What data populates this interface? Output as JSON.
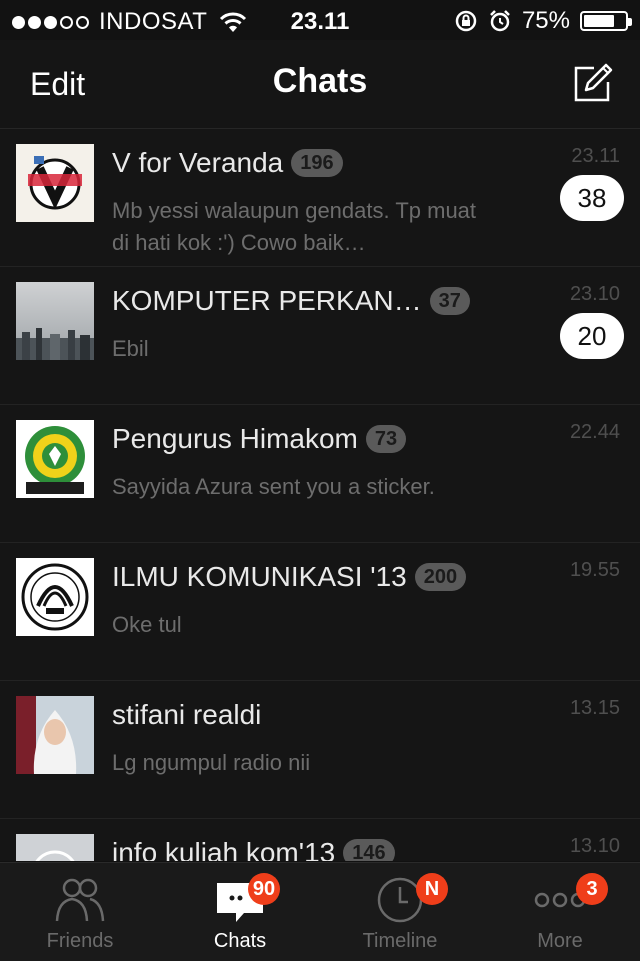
{
  "status_bar": {
    "carrier": "INDOSAT",
    "signal_bars_filled": 3,
    "signal_bars_total": 5,
    "time": "23.11",
    "battery": "75%",
    "battery_level": 0.75
  },
  "nav": {
    "edit_label": "Edit",
    "title": "Chats",
    "compose_icon": "compose-icon"
  },
  "chats": [
    {
      "name": "V for Veranda",
      "count": "196",
      "message": "Mb yessi walaupun gendats. Tp muat di hati kok :')   Cowo baik…",
      "time": "23.11",
      "unread": "38",
      "avatar": "logo-avatar"
    },
    {
      "name": "KOMPUTER PERKAN…",
      "count": "37",
      "message": "Ebil",
      "time": "23.10",
      "unread": "20",
      "avatar": "city-photo-avatar"
    },
    {
      "name": "Pengurus Himakom",
      "count": "73",
      "message": "Sayyida Azura sent you a sticker.",
      "time": "22.44",
      "unread": "",
      "avatar": "himakom-logo-avatar"
    },
    {
      "name": "ILMU KOMUNIKASI '13",
      "count": "200",
      "message": "Oke tul",
      "time": "19.55",
      "unread": "",
      "avatar": "university-seal-avatar"
    },
    {
      "name": "stifani realdi",
      "count": "",
      "message": "Lg ngumpul radio nii",
      "time": "13.15",
      "unread": "",
      "avatar": "person-photo-avatar"
    },
    {
      "name": "info kuliah kom'13",
      "count": "146",
      "message": "",
      "time": "13.10",
      "unread": "",
      "avatar": "group-default-avatar"
    }
  ],
  "tabs": [
    {
      "label": "Friends",
      "icon": "friends-icon",
      "badge": ""
    },
    {
      "label": "Chats",
      "icon": "chat-bubble-icon",
      "badge": "90"
    },
    {
      "label": "Timeline",
      "icon": "clock-icon",
      "badge": "N"
    },
    {
      "label": "More",
      "icon": "more-dots-icon",
      "badge": "3"
    }
  ],
  "colors": {
    "background": "#111111",
    "badge": "#ef3e1a",
    "unread_pill": "#ffffff",
    "count_pill": "#5a5a5a"
  }
}
